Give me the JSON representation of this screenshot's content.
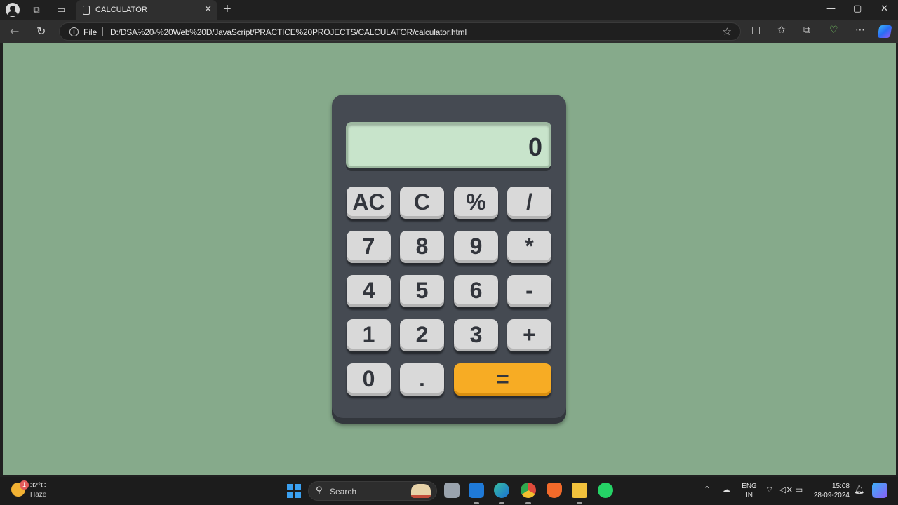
{
  "browser": {
    "tab_title": "CALCULATOR",
    "tab_close": "✕",
    "new_tab": "+",
    "file_label": "File",
    "url": "D:/DSA%20-%20Web%20D/JavaScript/PRACTICE%20PROJECTS/CALCULATOR/calculator.html"
  },
  "calculator": {
    "display": "0",
    "rows": [
      [
        "AC",
        "C",
        "%",
        "/"
      ],
      [
        "7",
        "8",
        "9",
        "*"
      ],
      [
        "4",
        "5",
        "6",
        "-"
      ],
      [
        "1",
        "2",
        "3",
        "+"
      ],
      [
        "0",
        ".",
        "="
      ]
    ],
    "equals_color": "#f7ac24",
    "key_color": "#d9d9d9",
    "body_color": "#454a52",
    "screen_color": "#c8e4cb",
    "background_color": "#86aa8b"
  },
  "taskbar": {
    "weather_temp": "32°C",
    "weather_desc": "Haze",
    "weather_badge": "1",
    "search_label": "Search",
    "lang_line1": "ENG",
    "lang_line2": "IN",
    "time": "15:08",
    "date": "28-09-2024"
  }
}
